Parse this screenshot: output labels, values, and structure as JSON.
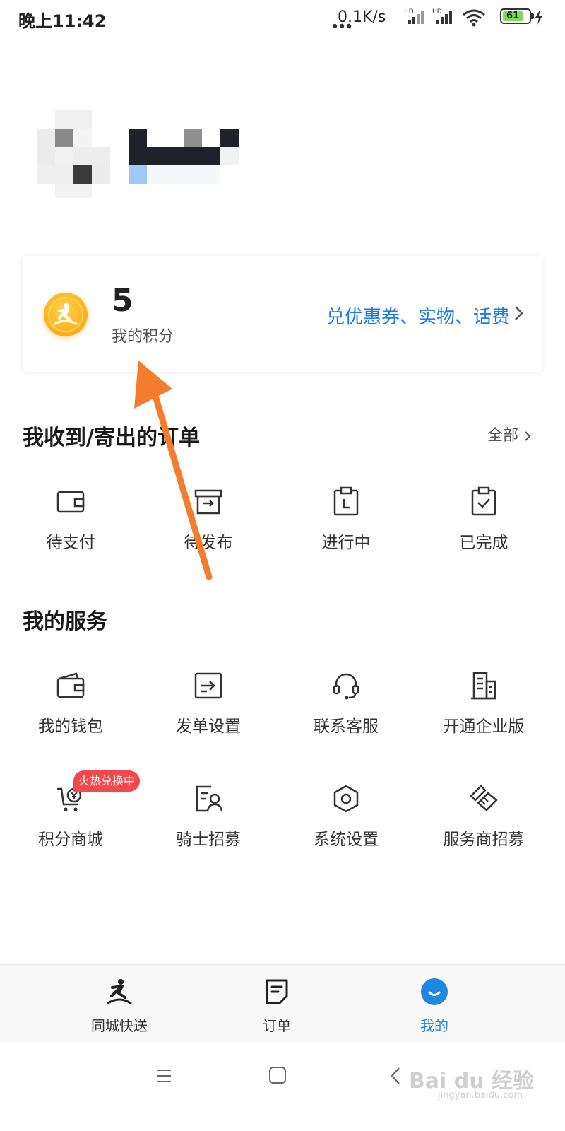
{
  "status_bar": {
    "time": "晚上11:42",
    "network_speed": "0.1K/s",
    "battery_level": "61"
  },
  "points_card": {
    "points": "5",
    "points_label": "我的积分",
    "redeem_text": "兑优惠券、实物、话费"
  },
  "orders": {
    "title": "我收到/寄出的订单",
    "all_label": "全部",
    "items": [
      {
        "label": "待支付",
        "icon": "wallet-icon"
      },
      {
        "label": "待发布",
        "icon": "box-icon"
      },
      {
        "label": "进行中",
        "icon": "clipboard-clock-icon"
      },
      {
        "label": "已完成",
        "icon": "clipboard-check-icon"
      }
    ]
  },
  "services": {
    "title": "我的服务",
    "items": [
      {
        "label": "我的钱包",
        "icon": "wallet-icon"
      },
      {
        "label": "发单设置",
        "icon": "send-settings-icon"
      },
      {
        "label": "联系客服",
        "icon": "headset-icon"
      },
      {
        "label": "开通企业版",
        "icon": "building-icon"
      },
      {
        "label": "积分商城",
        "icon": "cart-icon"
      },
      {
        "label": "骑士招募",
        "icon": "rider-recruit-icon"
      },
      {
        "label": "系统设置",
        "icon": "hexagon-settings-icon"
      },
      {
        "label": "服务商招募",
        "icon": "handshake-icon"
      }
    ],
    "hot_badge": "火热兑换中"
  },
  "bottom_nav": {
    "items": [
      {
        "label": "同城快送",
        "icon": "runner-icon"
      },
      {
        "label": "订单",
        "icon": "order-icon"
      },
      {
        "label": "我的",
        "icon": "profile-icon"
      }
    ],
    "active_index": 2
  },
  "colors": {
    "accent": "#1e88e5",
    "link": "#1e7ae6",
    "hot_badge": "#f0484c",
    "annotation_arrow": "#f57c2c"
  },
  "watermark": {
    "text": "Bai du 经验",
    "sub": "jingyan.baidu.com"
  }
}
